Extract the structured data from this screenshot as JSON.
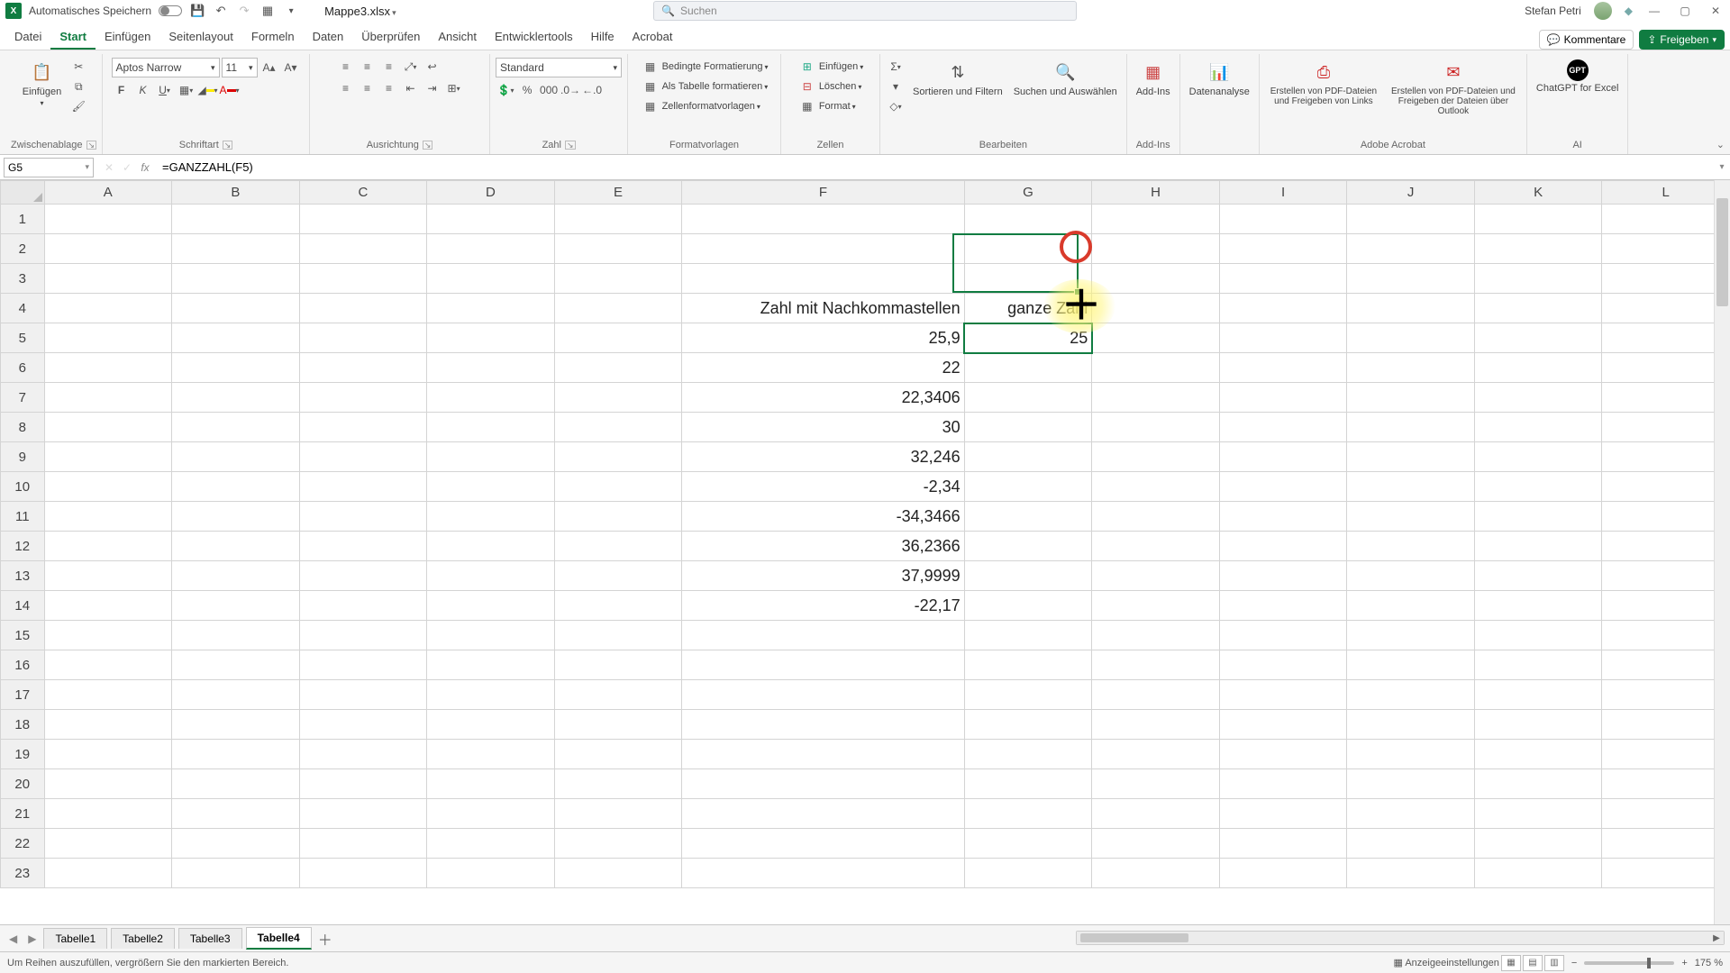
{
  "titlebar": {
    "autosave_label": "Automatisches Speichern",
    "filename": "Mappe3.xlsx",
    "search_placeholder": "Suchen",
    "user_name": "Stefan Petri"
  },
  "tabs": {
    "file": "Datei",
    "home": "Start",
    "insert": "Einfügen",
    "layout": "Seitenlayout",
    "formulas": "Formeln",
    "data": "Daten",
    "review": "Überprüfen",
    "view": "Ansicht",
    "developer": "Entwicklertools",
    "help": "Hilfe",
    "acrobat": "Acrobat",
    "comments": "Kommentare",
    "share": "Freigeben"
  },
  "ribbon": {
    "clipboard": {
      "paste": "Einfügen",
      "label": "Zwischenablage"
    },
    "font": {
      "name": "Aptos Narrow",
      "size": "11",
      "label": "Schriftart"
    },
    "align": {
      "label": "Ausrichtung"
    },
    "number": {
      "format": "Standard",
      "label": "Zahl"
    },
    "styles": {
      "cond": "Bedingte Formatierung",
      "table": "Als Tabelle formatieren",
      "cell": "Zellenformatvorlagen",
      "label": "Formatvorlagen"
    },
    "cells": {
      "insert": "Einfügen",
      "delete": "Löschen",
      "format": "Format",
      "label": "Zellen"
    },
    "editing": {
      "sort": "Sortieren und Filtern",
      "find": "Suchen und Auswählen",
      "label": "Bearbeiten"
    },
    "addins": {
      "addins": "Add-Ins",
      "label": "Add-Ins"
    },
    "analysis": {
      "btn": "Datenanalyse"
    },
    "acrobat": {
      "pdf1": "Erstellen von PDF-Dateien und Freigeben von Links",
      "pdf2": "Erstellen von PDF-Dateien und Freigeben der Dateien über Outlook",
      "label": "Adobe Acrobat"
    },
    "ai": {
      "gpt": "ChatGPT for Excel",
      "label": "AI"
    }
  },
  "formula_bar": {
    "cell_ref": "G5",
    "formula": "=GANZZAHL(F5)"
  },
  "columns": [
    "A",
    "B",
    "C",
    "D",
    "E",
    "F",
    "G",
    "H",
    "I",
    "J",
    "K",
    "L"
  ],
  "rows": [
    "1",
    "2",
    "3",
    "4",
    "5",
    "6",
    "7",
    "8",
    "9",
    "10",
    "11",
    "12",
    "13",
    "14",
    "15",
    "16",
    "17",
    "18",
    "19",
    "20",
    "21",
    "22",
    "23"
  ],
  "cells": {
    "F4": "Zahl mit Nachkommastellen",
    "G4": "ganze Zahl",
    "F5": "25,9",
    "G5": "25",
    "F6": "22",
    "F7": "22,3406",
    "F8": "30",
    "F9": "32,246",
    "F10": "-2,34",
    "F11": "-34,3466",
    "F12": "36,2366",
    "F13": "37,9999",
    "F14": "-22,17"
  },
  "sheets": {
    "t1": "Tabelle1",
    "t2": "Tabelle2",
    "t3": "Tabelle3",
    "t4": "Tabelle4"
  },
  "statusbar": {
    "hint": "Um Reihen auszufüllen, vergrößern Sie den markierten Bereich.",
    "display": "Anzeigeeinstellungen",
    "zoom": "175 %"
  }
}
